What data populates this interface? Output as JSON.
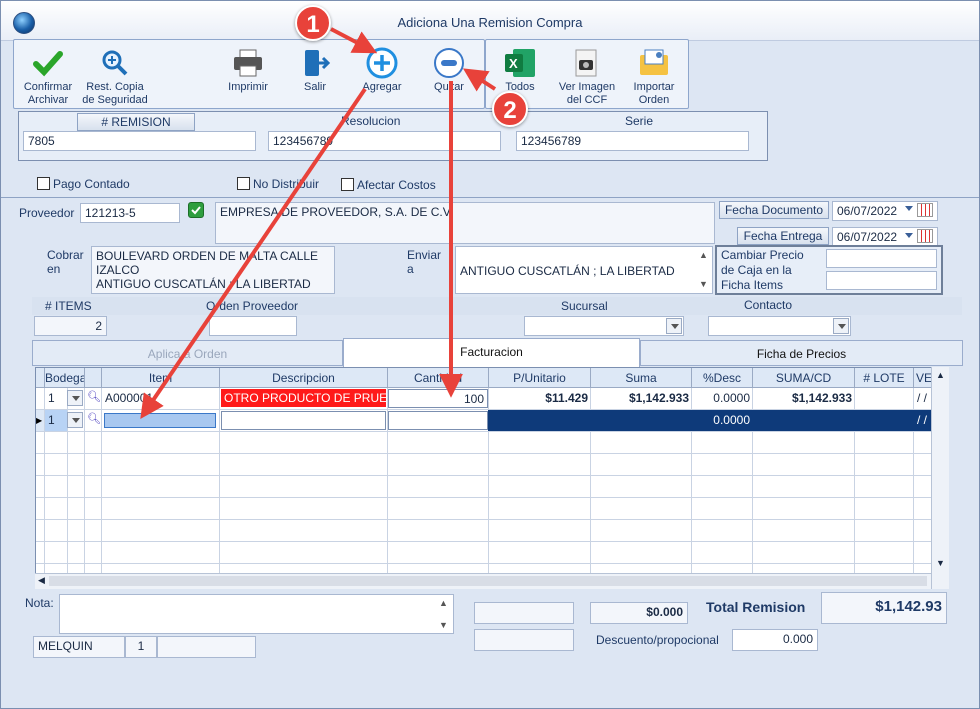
{
  "window": {
    "title": "Adiciona Una Remision Compra"
  },
  "toolbar": {
    "confirmar": "Confirmar\nArchivar",
    "rest_copia": "Rest. Copia\nde Seguridad",
    "imprimir": "Imprimir",
    "salir": "Salir",
    "agregar": "Agregar",
    "quitar": "Quitar",
    "todos": "Todos",
    "ver_imagen": "Ver Imagen\ndel CCF",
    "importar": "Importar\nOrden"
  },
  "header": {
    "remision_label": "# REMISION",
    "remision_value": "7805",
    "resolucion_label": "Resolucion",
    "resolucion_value": "123456789",
    "serie_label": "Serie",
    "serie_value": "123456789"
  },
  "options": {
    "pago_contado": "Pago Contado",
    "no_distribuir": "No Distribuir",
    "afectar_costos": "Afectar Costos"
  },
  "proveedor": {
    "label": "Proveedor",
    "code": "121213-5",
    "name": "EMPRESA DE PROVEEDOR, S.A. DE C.V."
  },
  "fechas": {
    "doc_label": "Fecha Documento",
    "doc_value": "06/07/2022",
    "entrega_label": "Fecha Entrega",
    "entrega_value": "06/07/2022"
  },
  "cobrar": {
    "label": "Cobrar\nen",
    "value": "BOULEVARD ORDEN DE MALTA CALLE\nIZALCO\nANTIGUO CUSCATLÁN ; LA LIBERTAD"
  },
  "enviar": {
    "label": "Enviar\na",
    "value": "ANTIGUO CUSCATLÁN ; LA LIBERTAD"
  },
  "cambiar_precio": "Cambiar Precio\nde Caja en la\nFicha Items",
  "summary": {
    "items_label": "# ITEMS",
    "items_value": "2",
    "orden_label": "Orden Proveedor",
    "sucursal_label": "Sucursal",
    "contacto_label": "Contacto"
  },
  "tabs": [
    "Aplica a Orden",
    "Facturacion",
    "Ficha de Precios"
  ],
  "grid": {
    "columns": [
      "Bodega",
      "Item",
      "Descripcion",
      "Cantidad",
      "P/Unitario",
      "Suma",
      "%Desc",
      "SUMA/CD",
      "# LOTE",
      "VENC"
    ],
    "rows": [
      {
        "bodega": "1",
        "item": "A000001",
        "descripcion": "OTRO PRODUCTO DE PRUEBA",
        "cantidad": "100",
        "punitario": "$11.429",
        "suma": "$1,142.933",
        "desc": "0.0000",
        "sumacd": "$1,142.933",
        "lote": "",
        "venc": "/ /"
      },
      {
        "bodega": "1",
        "item": "",
        "descripcion": "",
        "cantidad": "",
        "punitario": "",
        "suma": "",
        "desc": "0.0000",
        "sumacd": "",
        "lote": "",
        "venc": "/ /"
      }
    ]
  },
  "footer": {
    "nota_label": "Nota:",
    "subtotal": "$0.000",
    "total_label": "Total Remision",
    "total_value": "$1,142.93",
    "descuento_label": "Descuento/propocional",
    "descuento_value": "0.000",
    "user": "MELQUIN",
    "user_num": "1"
  },
  "annotations": {
    "one": "1",
    "two": "2"
  },
  "colors": {
    "accent": "#e8423a",
    "selected_row": "#0e3a7a",
    "desc_cell": "#ff1a1a"
  }
}
